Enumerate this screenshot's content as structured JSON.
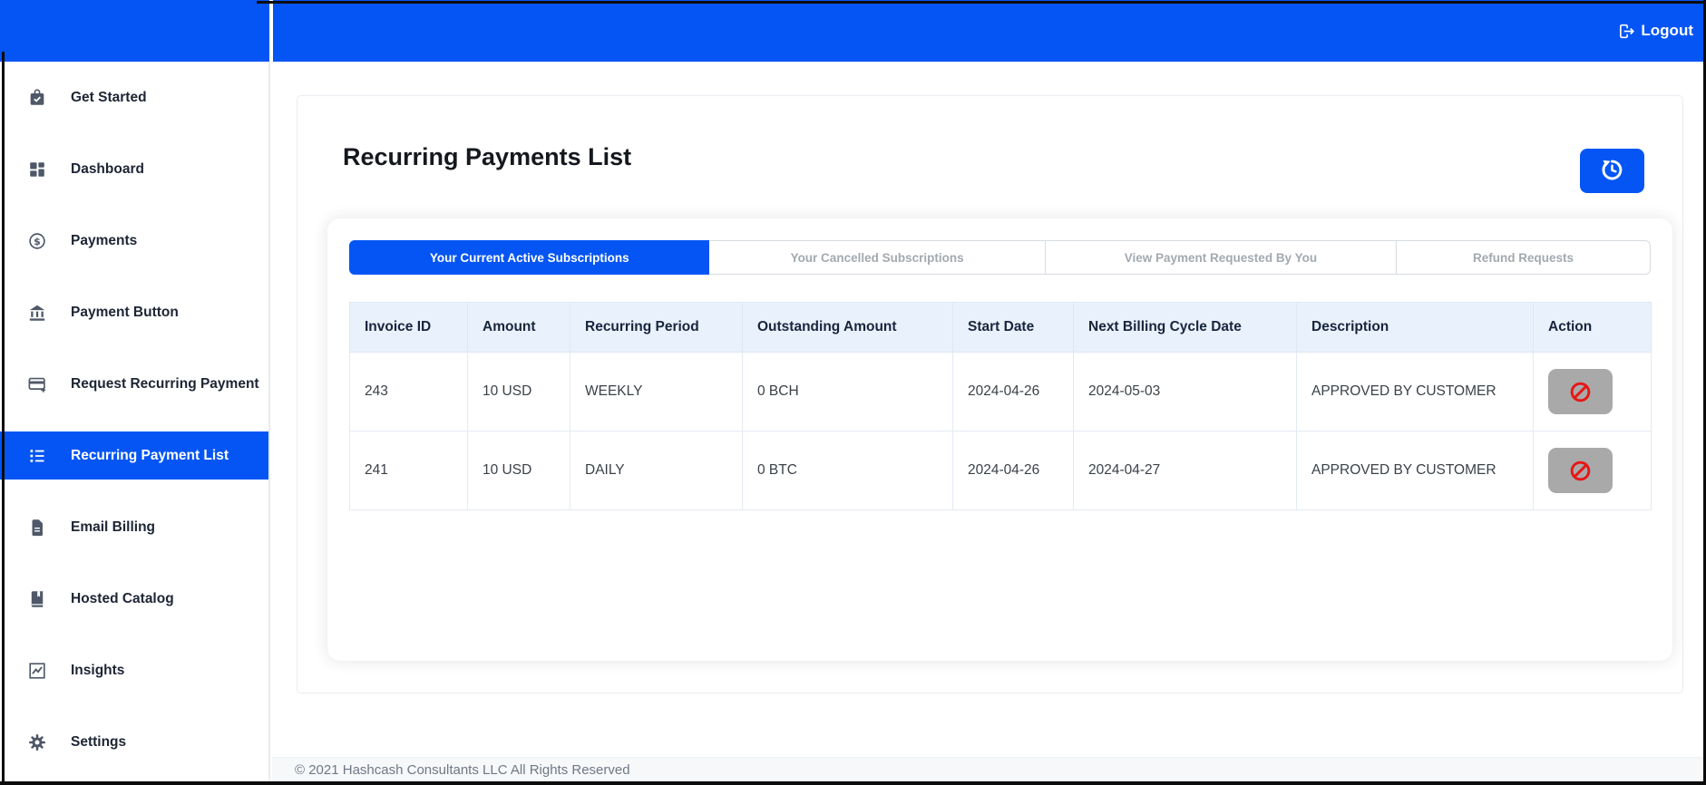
{
  "colors": {
    "primary": "#0455f4",
    "ban_red": "#e81515",
    "action_gray": "#a9a9a9",
    "table_header_bg": "#e9f1fc"
  },
  "topbar": {
    "logout_label": "Logout"
  },
  "sidebar": {
    "items": [
      {
        "label": "Get Started",
        "icon": "briefcase-check-icon",
        "active": false
      },
      {
        "label": "Dashboard",
        "icon": "grid-icon",
        "active": false
      },
      {
        "label": "Payments",
        "icon": "dollar-circle-icon",
        "active": false
      },
      {
        "label": "Payment Button",
        "icon": "bank-icon",
        "active": false
      },
      {
        "label": "Request Recurring Payment",
        "icon": "card-plus-icon",
        "active": false
      },
      {
        "label": "Recurring Payment List",
        "icon": "list-icon",
        "active": true
      },
      {
        "label": "Email Billing",
        "icon": "document-icon",
        "active": false
      },
      {
        "label": "Hosted Catalog",
        "icon": "book-icon",
        "active": false
      },
      {
        "label": "Insights",
        "icon": "chart-icon",
        "active": false
      },
      {
        "label": "Settings",
        "icon": "gear-icon",
        "active": false
      }
    ]
  },
  "main": {
    "title": "Recurring Payments List",
    "tabs": [
      {
        "label": "Your Current Active Subscriptions",
        "active": true
      },
      {
        "label": "Your Cancelled Subscriptions",
        "active": false
      },
      {
        "label": "View Payment Requested By You",
        "active": false
      },
      {
        "label": "Refund Requests",
        "active": false
      }
    ],
    "table": {
      "columns": [
        "Invoice ID",
        "Amount",
        "Recurring Period",
        "Outstanding Amount",
        "Start Date",
        "Next Billing Cycle Date",
        "Description",
        "Action"
      ],
      "rows": [
        {
          "invoice_id": "243",
          "amount": "10 USD",
          "recurring_period": "WEEKLY",
          "outstanding_amount": "0 BCH",
          "start_date": "2024-04-26",
          "next_billing_cycle_date": "2024-05-03",
          "description": "APPROVED BY CUSTOMER",
          "action_icon": "ban-icon"
        },
        {
          "invoice_id": "241",
          "amount": "10 USD",
          "recurring_period": "DAILY",
          "outstanding_amount": "0 BTC",
          "start_date": "2024-04-26",
          "next_billing_cycle_date": "2024-04-27",
          "description": "APPROVED BY CUSTOMER",
          "action_icon": "ban-icon"
        }
      ]
    }
  },
  "footer": {
    "copyright": "© 2021 Hashcash Consultants LLC All Rights Reserved"
  }
}
